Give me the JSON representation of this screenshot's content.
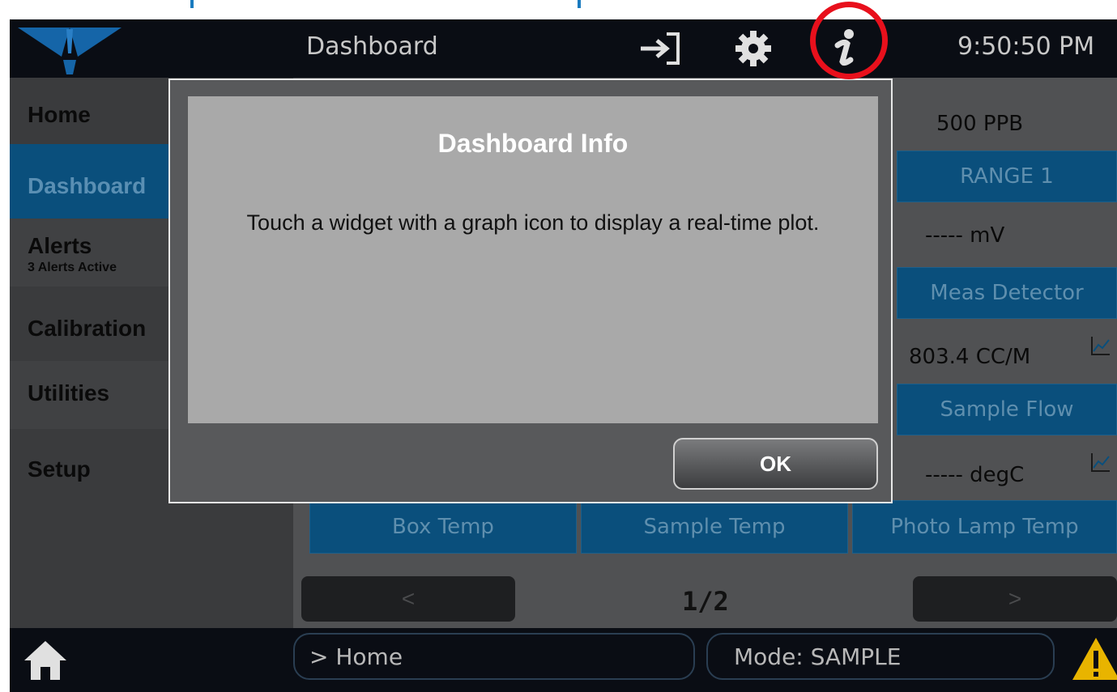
{
  "header": {
    "title": "Dashboard",
    "time": "9:50:50 PM",
    "icons": [
      "logout-icon",
      "gear-icon",
      "info-icon"
    ]
  },
  "sidebar": {
    "items": [
      {
        "label": "Home",
        "sub": ""
      },
      {
        "label": "Dashboard",
        "sub": ""
      },
      {
        "label": "Alerts",
        "sub": "3 Alerts Active"
      },
      {
        "label": "Calibration",
        "sub": ""
      },
      {
        "label": "Utilities",
        "sub": ""
      },
      {
        "label": "Setup",
        "sub": ""
      }
    ]
  },
  "widgets": {
    "range_value": "500 PPB",
    "range_label": "RANGE 1",
    "detector_value": "----- mV",
    "detector_label": "Meas Detector",
    "flow_value": "803.4 CC/M",
    "flow_label": "Sample Flow",
    "temp_value": "----- degC",
    "box_temp_label": "Box Temp",
    "sample_temp_label": "Sample Temp",
    "lamp_temp_label": "Photo Lamp Temp"
  },
  "pager": {
    "prev": "<",
    "page": "1/2",
    "next": ">"
  },
  "footer": {
    "breadcrumb": "> Home",
    "mode": "Mode: SAMPLE"
  },
  "modal": {
    "title": "Dashboard Info",
    "message": "Touch a widget with a  graph icon to display a real-time plot.",
    "ok_label": "OK"
  },
  "colors": {
    "accent_blue": "#0a4f7c",
    "highlight_red": "#e8101c",
    "warning_yellow": "#e8b400"
  }
}
